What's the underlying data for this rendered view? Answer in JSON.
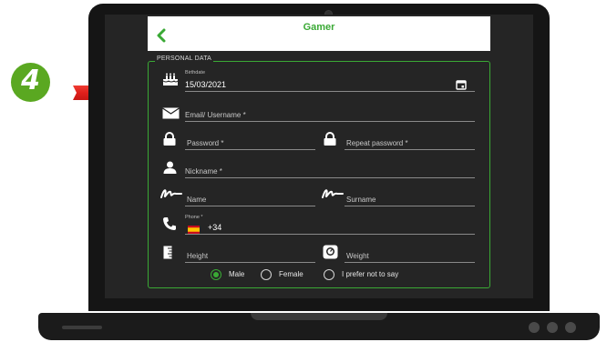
{
  "step_badge": {
    "number": "4",
    "color": "#5aa821"
  },
  "header": {
    "title": "Gamer",
    "back_icon": "chevron-left-icon"
  },
  "form": {
    "section_title": "PERSONAL DATA",
    "birthdate": {
      "label": "Birthdate",
      "value": "15/03/2021",
      "icon": "cake-icon",
      "trailing_icon": "calendar-icon"
    },
    "email": {
      "placeholder": "Email/ Username *",
      "icon": "envelope-icon"
    },
    "password": {
      "placeholder": "Password *",
      "icon": "lock-icon"
    },
    "repeat_password": {
      "placeholder": "Repeat password *",
      "icon": "lock-icon"
    },
    "nickname": {
      "placeholder": "Nickname *",
      "icon": "person-icon"
    },
    "name": {
      "placeholder": "Name",
      "icon": "signature-icon"
    },
    "surname": {
      "placeholder": "Surname",
      "icon": "signature-icon"
    },
    "phone": {
      "label": "Phone *",
      "prefix": "+34",
      "icon": "phone-icon",
      "flag": "spain-flag-icon"
    },
    "height": {
      "placeholder": "Height",
      "icon": "ruler-icon"
    },
    "weight": {
      "placeholder": "Weight",
      "icon": "scale-icon"
    },
    "gender": {
      "options": [
        "Male",
        "Female",
        "I prefer not to say"
      ],
      "selected": "Male"
    }
  },
  "colors": {
    "accent": "#3aa935",
    "screen_bg": "#252525",
    "arrow": "#e0201b"
  }
}
